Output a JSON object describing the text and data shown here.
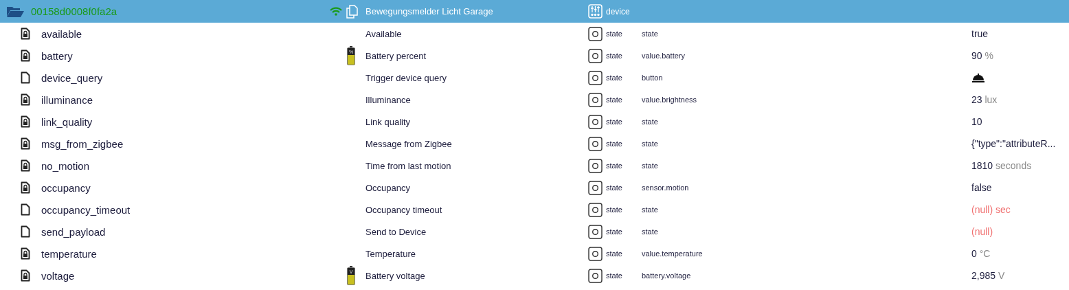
{
  "device": {
    "id": "00158d0008f0fa2a",
    "online": true,
    "name": "Bewegungsmelder Licht Garage",
    "type": "device"
  },
  "states": [
    {
      "id": "available",
      "locked": true,
      "name": "Available",
      "type": "state",
      "role": "state",
      "value": {
        "kind": "text",
        "text": "true"
      }
    },
    {
      "id": "battery",
      "locked": true,
      "battery_icon": {
        "label": "%"
      },
      "name": "Battery percent",
      "type": "state",
      "role": "value.battery",
      "value": {
        "kind": "text",
        "text": "90",
        "unit": "%"
      }
    },
    {
      "id": "device_query",
      "locked": false,
      "name": "Trigger device query",
      "type": "state",
      "role": "button",
      "value": {
        "kind": "button"
      }
    },
    {
      "id": "illuminance",
      "locked": true,
      "name": "Illuminance",
      "type": "state",
      "role": "value.brightness",
      "value": {
        "kind": "text",
        "text": "23",
        "unit": "lux"
      }
    },
    {
      "id": "link_quality",
      "locked": true,
      "name": "Link quality",
      "type": "state",
      "role": "state",
      "value": {
        "kind": "text",
        "text": "10"
      }
    },
    {
      "id": "msg_from_zigbee",
      "locked": true,
      "name": "Message from Zigbee",
      "type": "state",
      "role": "state",
      "value": {
        "kind": "text",
        "text": "{\"type\":\"attributeR..."
      }
    },
    {
      "id": "no_motion",
      "locked": true,
      "name": "Time from last motion",
      "type": "state",
      "role": "state",
      "value": {
        "kind": "text",
        "text": "1810",
        "unit": "seconds"
      }
    },
    {
      "id": "occupancy",
      "locked": true,
      "name": "Occupancy",
      "type": "state",
      "role": "sensor.motion",
      "value": {
        "kind": "text",
        "text": "false"
      }
    },
    {
      "id": "occupancy_timeout",
      "locked": false,
      "name": "Occupancy timeout",
      "type": "state",
      "role": "state",
      "value": {
        "kind": "null",
        "text": "(null)",
        "unit": "sec"
      }
    },
    {
      "id": "send_payload",
      "locked": false,
      "name": "Send to Device",
      "type": "state",
      "role": "state",
      "value": {
        "kind": "null",
        "text": "(null)"
      }
    },
    {
      "id": "temperature",
      "locked": true,
      "name": "Temperature",
      "type": "state",
      "role": "value.temperature",
      "value": {
        "kind": "text",
        "text": "0",
        "unit": "°C"
      }
    },
    {
      "id": "voltage",
      "locked": true,
      "battery_icon": {
        "label": "V"
      },
      "name": "Battery voltage",
      "type": "state",
      "role": "battery.voltage",
      "value": {
        "kind": "text",
        "text": "2,985",
        "unit": "V"
      }
    }
  ]
}
